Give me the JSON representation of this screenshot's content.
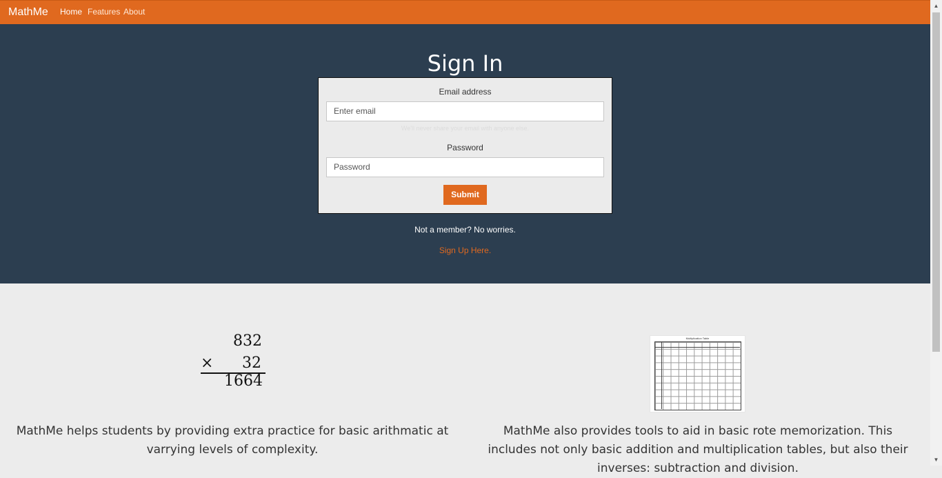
{
  "nav": {
    "brand": "MathMe",
    "links": [
      "Home",
      "Features",
      "About"
    ]
  },
  "signin": {
    "title": "Sign In",
    "email_label": "Email address",
    "email_placeholder": "Enter email",
    "email_help": "We'll never share your email with anyone else.",
    "password_label": "Password",
    "password_placeholder": "Password",
    "submit_label": "Submit",
    "member_text": "Not a member? No worries.",
    "signup_link": "Sign Up Here."
  },
  "math_example": {
    "top": "832",
    "operator": "×",
    "bottom": "32",
    "result": "1664"
  },
  "table_image": {
    "title": "Multiplication Table"
  },
  "features": {
    "left_text": "MathMe helps students by providing extra practice for basic arithmatic at varrying levels of complexity.",
    "right_text": "MathMe also provides tools to aid in basic rote memorization. This includes not only basic addition and multiplication tables, but also their inverses: subtraction and division."
  },
  "colors": {
    "accent": "#e0691f",
    "hero": "#2c3e50",
    "background": "#ececec"
  }
}
